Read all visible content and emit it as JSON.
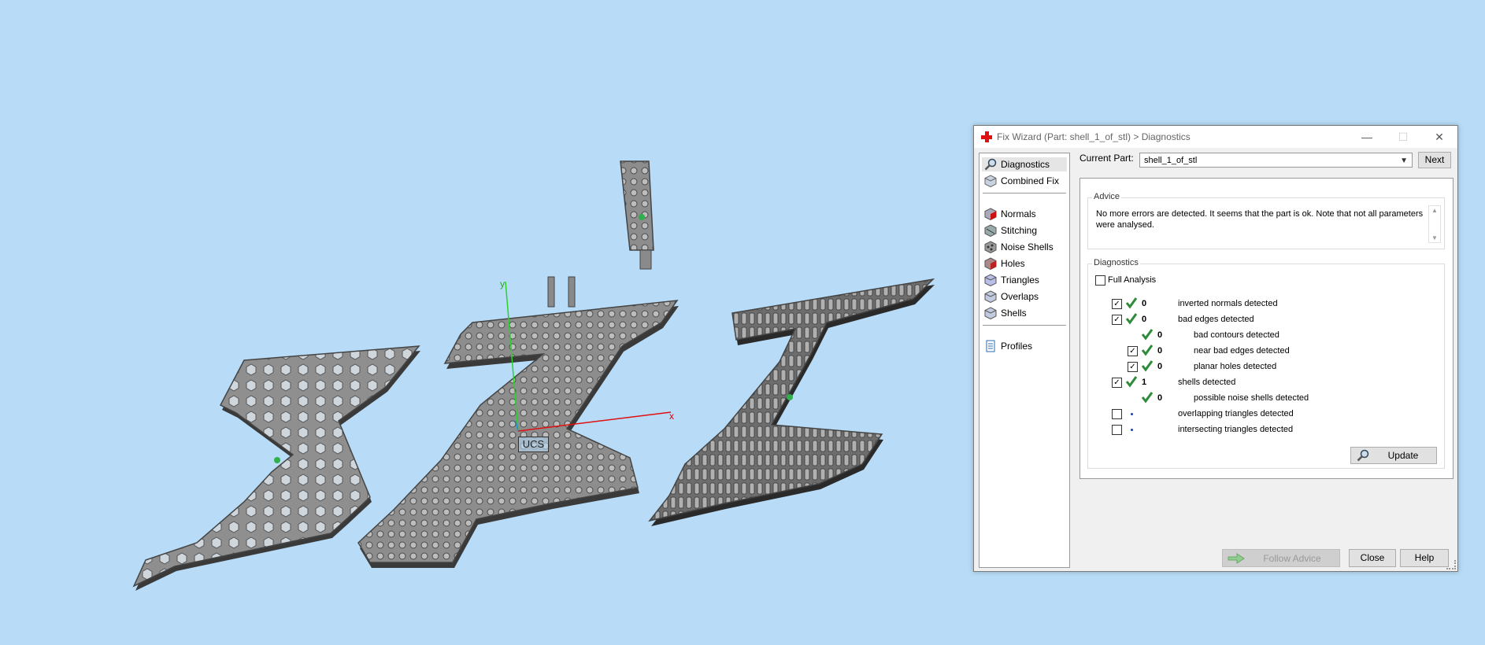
{
  "viewport": {
    "ucs_label": "UCS",
    "axis_x": "x",
    "axis_y": "y"
  },
  "dialog": {
    "title": "Fix Wizard (Part: shell_1_of_stl) > Diagnostics",
    "window_buttons": {
      "minimize": "—",
      "maximize": "☐",
      "close": "✕"
    },
    "nav": {
      "items": [
        {
          "label": "Diagnostics",
          "icon": "magnifier-icon",
          "selected": true
        },
        {
          "label": "Combined Fix",
          "icon": "cube-icon"
        },
        {
          "label": "Normals",
          "icon": "normals-cube-icon"
        },
        {
          "label": "Stitching",
          "icon": "stitching-cube-icon"
        },
        {
          "label": "Noise Shells",
          "icon": "noise-shells-icon"
        },
        {
          "label": "Holes",
          "icon": "holes-cube-icon"
        },
        {
          "label": "Triangles",
          "icon": "triangles-cube-icon"
        },
        {
          "label": "Overlaps",
          "icon": "overlaps-cube-icon"
        },
        {
          "label": "Shells",
          "icon": "shells-cube-icon"
        },
        {
          "label": "Profiles",
          "icon": "document-icon"
        }
      ]
    },
    "current_part_label": "Current Part:",
    "current_part_value": "shell_1_of_stl",
    "next_label": "Next",
    "advice": {
      "title": "Advice",
      "text": "No more errors are detected. It seems that the part is ok. Note that not all parameters were analysed."
    },
    "diagnostics": {
      "title": "Diagnostics",
      "full_analysis_label": "Full Analysis",
      "rows": [
        {
          "checked": true,
          "status": "ok",
          "count": "0",
          "label": "inverted normals detected",
          "indent": 0,
          "has_checkbox": true
        },
        {
          "checked": true,
          "status": "ok",
          "count": "0",
          "label": "bad edges detected",
          "indent": 0,
          "has_checkbox": true
        },
        {
          "checked": false,
          "status": "ok",
          "count": "0",
          "label": "bad contours detected",
          "indent": 1,
          "has_checkbox": false
        },
        {
          "checked": true,
          "status": "ok",
          "count": "0",
          "label": "near bad edges detected",
          "indent": 1,
          "has_checkbox": true
        },
        {
          "checked": true,
          "status": "ok",
          "count": "0",
          "label": "planar holes detected",
          "indent": 1,
          "has_checkbox": true
        },
        {
          "checked": true,
          "status": "ok",
          "count": "1",
          "label": "shells detected",
          "indent": 0,
          "has_checkbox": true
        },
        {
          "checked": false,
          "status": "ok",
          "count": "0",
          "label": "possible noise shells detected",
          "indent": 1,
          "has_checkbox": false
        },
        {
          "checked": false,
          "status": "unknown",
          "count": "",
          "label": "overlapping triangles detected",
          "indent": 0,
          "has_checkbox": true
        },
        {
          "checked": false,
          "status": "unknown",
          "count": "",
          "label": "intersecting triangles detected",
          "indent": 0,
          "has_checkbox": true
        }
      ],
      "update_label": "Update"
    },
    "footer": {
      "follow_advice_label": "Follow Advice",
      "close_label": "Close",
      "help_label": "Help"
    },
    "colors": {
      "check_green": "#2e8b3a",
      "background": "#b8dcf7",
      "part_gray": "#8a8a8a"
    }
  }
}
